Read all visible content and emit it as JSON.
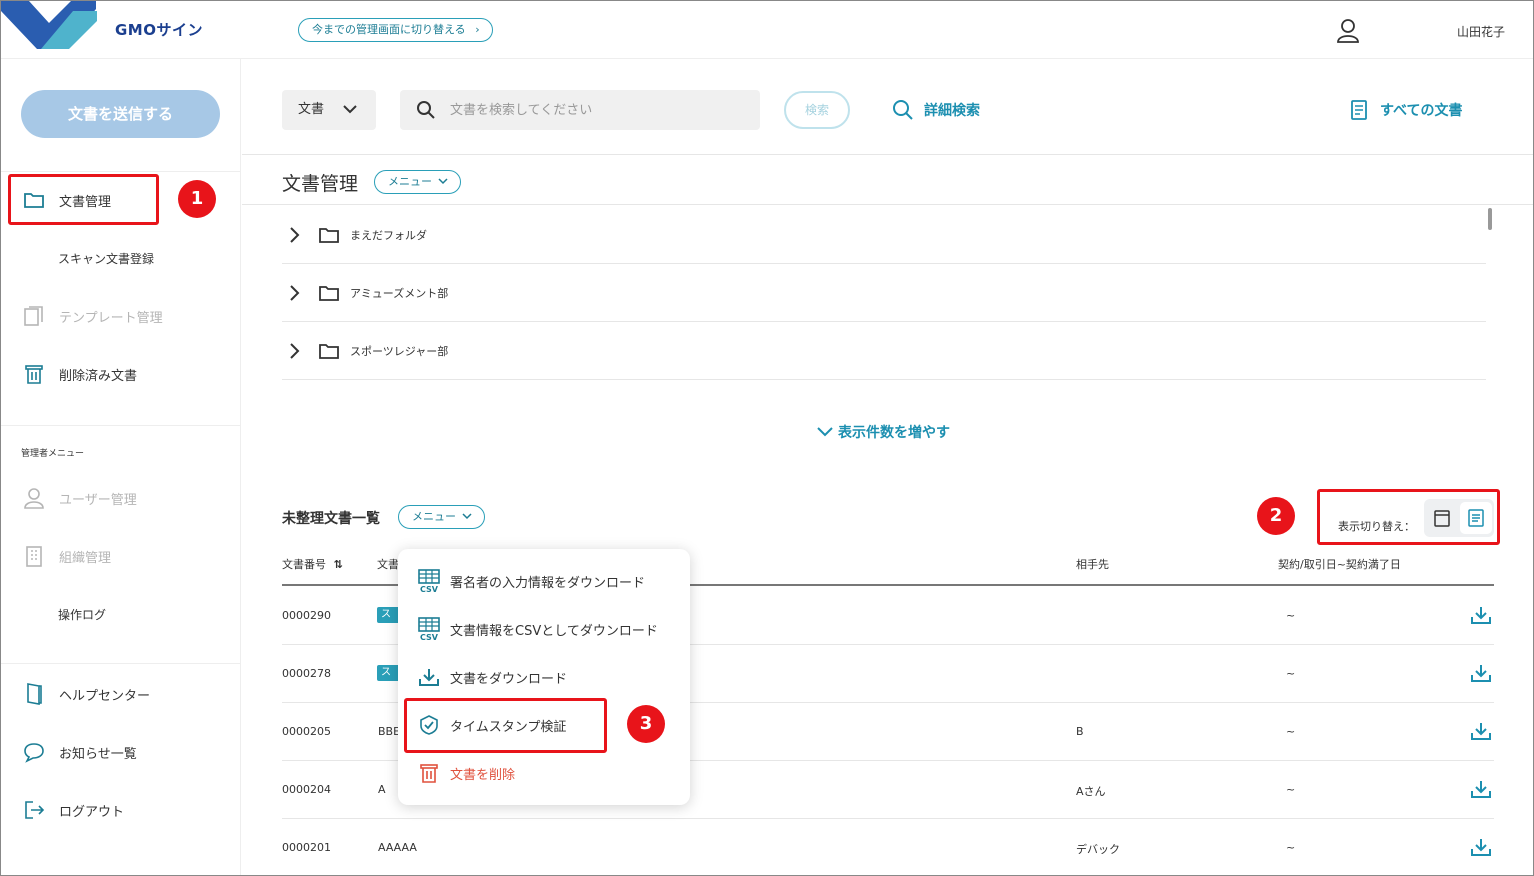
{
  "header": {
    "brand": "GMOサイン",
    "switch_label": "今までの管理画面に切り替える",
    "user_name": "山田花子"
  },
  "sidebar": {
    "send_button": "文書を送信する",
    "items": [
      {
        "label": "文書管理"
      },
      {
        "label": "スキャン文書登録"
      },
      {
        "label": "テンプレート管理"
      },
      {
        "label": "削除済み文書"
      }
    ],
    "admin_caption": "管理者メニュー",
    "admin_items": [
      {
        "label": "ユーザー管理"
      },
      {
        "label": "組織管理"
      },
      {
        "label": "操作ログ"
      }
    ],
    "footer_items": [
      {
        "label": "ヘルプセンター"
      },
      {
        "label": "お知らせ一覧"
      },
      {
        "label": "ログアウト"
      }
    ]
  },
  "toolbar": {
    "type_select": "文書",
    "search_placeholder": "文書を検索してください",
    "search_button": "検索",
    "advanced_search": "詳細検索",
    "all_documents": "すべての文書"
  },
  "main": {
    "title": "文書管理",
    "menu_label": "メニュー",
    "folders": [
      {
        "name": "まえだフォルダ"
      },
      {
        "name": "アミューズメント部"
      },
      {
        "name": "スポーツレジャー部"
      }
    ],
    "show_more": "表示件数を増やす",
    "list_title": "未整理文書一覧",
    "list_menu_label": "メニュー",
    "view_switch_label": "表示切り替え：",
    "columns": {
      "number": "文書番号",
      "doc": "文書",
      "partner": "相手先",
      "date": "契約/取引日~契約満了日"
    },
    "rows": [
      {
        "number": "0000290",
        "doc": "ス",
        "partner": "",
        "date": "~"
      },
      {
        "number": "0000278",
        "doc": "ス",
        "partner": "",
        "date": "~"
      },
      {
        "number": "0000205",
        "doc": "BBE",
        "partner": "B",
        "date": "~"
      },
      {
        "number": "0000204",
        "doc": "A",
        "partner": "Aさん",
        "date": "~"
      },
      {
        "number": "0000201",
        "doc": "AAAAA",
        "partner": "デバック",
        "date": "~"
      }
    ]
  },
  "dropdown": {
    "items": [
      {
        "label": "署名者の入力情報をダウンロード",
        "icon": "csv-icon"
      },
      {
        "label": "文書情報をCSVとしてダウンロード",
        "icon": "csv-icon"
      },
      {
        "label": "文書をダウンロード",
        "icon": "download-icon"
      },
      {
        "label": "タイムスタンプ検証",
        "icon": "check-circle-icon"
      },
      {
        "label": "文書を削除",
        "icon": "trash-icon"
      }
    ]
  },
  "annotations": [
    "1",
    "2",
    "3"
  ],
  "colors": {
    "accent": "#1c8fb0",
    "annotation_red": "#e8141a",
    "send_button_bg": "#a7c8e6",
    "danger": "#e0513d"
  }
}
